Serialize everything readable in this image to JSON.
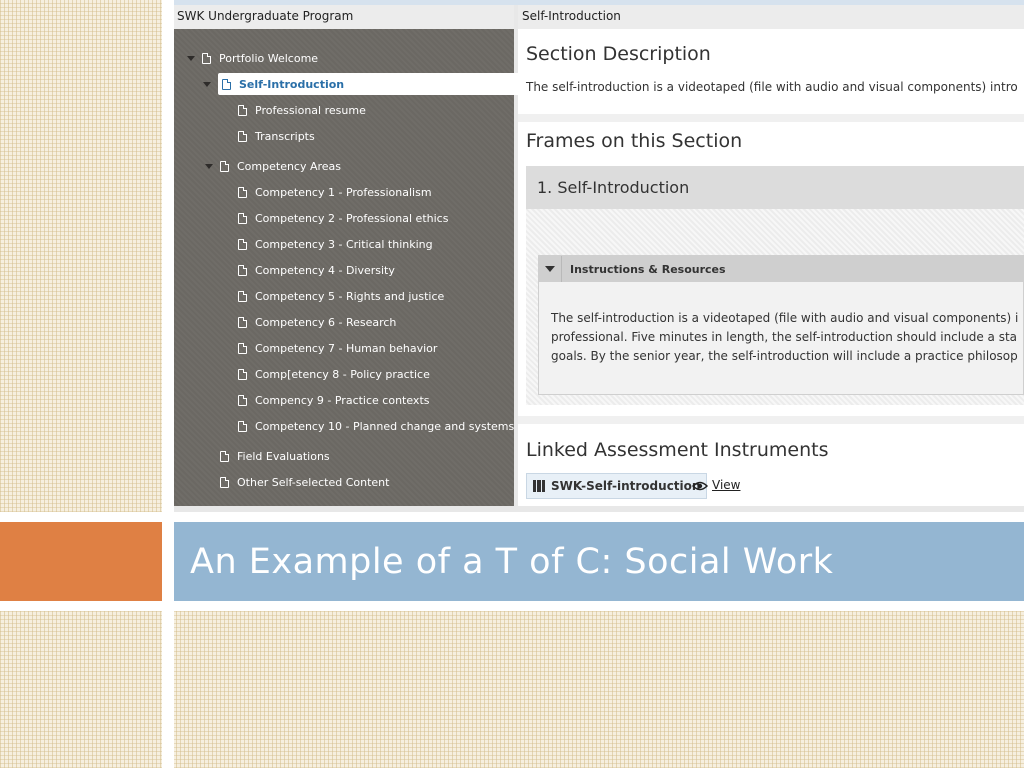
{
  "slide": {
    "title": "An Example of a T of C: Social Work"
  },
  "screenshot": {
    "left_header": "SWK Undergraduate Program",
    "right_header": "Self-Introduction",
    "tree": [
      {
        "label": "Portfolio Welcome",
        "level": 0,
        "caret": true
      },
      {
        "label": "Self-Introduction",
        "level": 1,
        "caret": true,
        "selected": true
      },
      {
        "label": "Professional resume",
        "level": 2
      },
      {
        "label": "Transcripts",
        "level": 2
      },
      {
        "label": "Competency Areas",
        "level": 1,
        "caret": true
      },
      {
        "label": "Competency 1 - Professionalism",
        "level": 2
      },
      {
        "label": "Competency 2 - Professional ethics",
        "level": 2
      },
      {
        "label": "Competency 3 - Critical thinking",
        "level": 2
      },
      {
        "label": "Competency 4 - Diversity",
        "level": 2
      },
      {
        "label": "Competency 5 - Rights and justice",
        "level": 2
      },
      {
        "label": "Competency 6 - Research",
        "level": 2
      },
      {
        "label": "Competency 7 - Human behavior",
        "level": 2
      },
      {
        "label": "Comp[etency 8 - Policy practice",
        "level": 2
      },
      {
        "label": "Compency 9 - Practice contexts",
        "level": 2
      },
      {
        "label": "Competency 10 - Planned change and systems",
        "level": 2
      },
      {
        "label": "Field Evaluations",
        "level": 1
      },
      {
        "label": "Other Self-selected Content",
        "level": 1
      }
    ],
    "main": {
      "section_title": "Section Description",
      "section_text": "The self-introduction is a videotaped (file with audio and visual components) intro",
      "frames_title": "Frames on this Section",
      "frame_name": "1. Self-Introduction",
      "instructions_label": "Instructions & Resources",
      "instructions_lines": [
        "The self-introduction is a videotaped (file with audio and visual components) i",
        "professional. Five minutes in length, the self-introduction should include a sta",
        "goals. By the senior year, the self-introduction will include a practice philosop"
      ],
      "linked_title": "Linked Assessment Instruments",
      "linked_item": "SWK-Self-introduction",
      "view_label": "View"
    }
  },
  "colors": {
    "accent_orange": "#df8044",
    "title_band": "#94b6d2",
    "tree_bg": "#6b6863",
    "selected_text": "#2a6fa8"
  }
}
